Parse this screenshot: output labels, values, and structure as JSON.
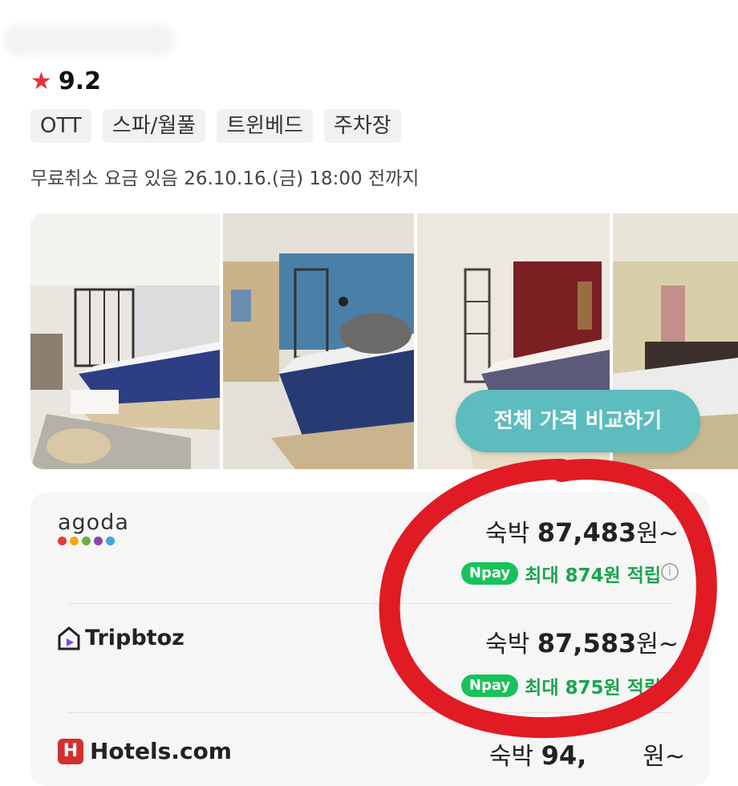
{
  "header": {
    "rating": {
      "icon": "star-icon",
      "score": "9.2"
    },
    "tags": [
      "OTT",
      "스파/월풀",
      "트윈베드",
      "주차장"
    ],
    "cancel_policy": "무료취소 요금 있음 26.10.16.(금) 18:00 전까지"
  },
  "gallery": {
    "compare_button": "전체 가격 비교하기"
  },
  "prices": [
    {
      "provider": "agoda",
      "prefix": "숙박",
      "amount": "87,483",
      "suffix": "원~",
      "reward": {
        "badge": "Npay",
        "text": "최대 874원 적립"
      }
    },
    {
      "provider": "Tripbtoz",
      "prefix": "숙박",
      "amount": "87,583",
      "suffix": "원~",
      "reward": {
        "badge": "Npay",
        "text": "최대 875원 적립"
      }
    },
    {
      "provider": "Hotels.com",
      "prefix": "숙박",
      "amount": "94,",
      "suffix": "원~"
    }
  ],
  "colors": {
    "accent_teal": "#5cbcbe",
    "npay_green": "#19c15b",
    "star_red": "#e8323c",
    "annotation_red": "#e01b24"
  }
}
